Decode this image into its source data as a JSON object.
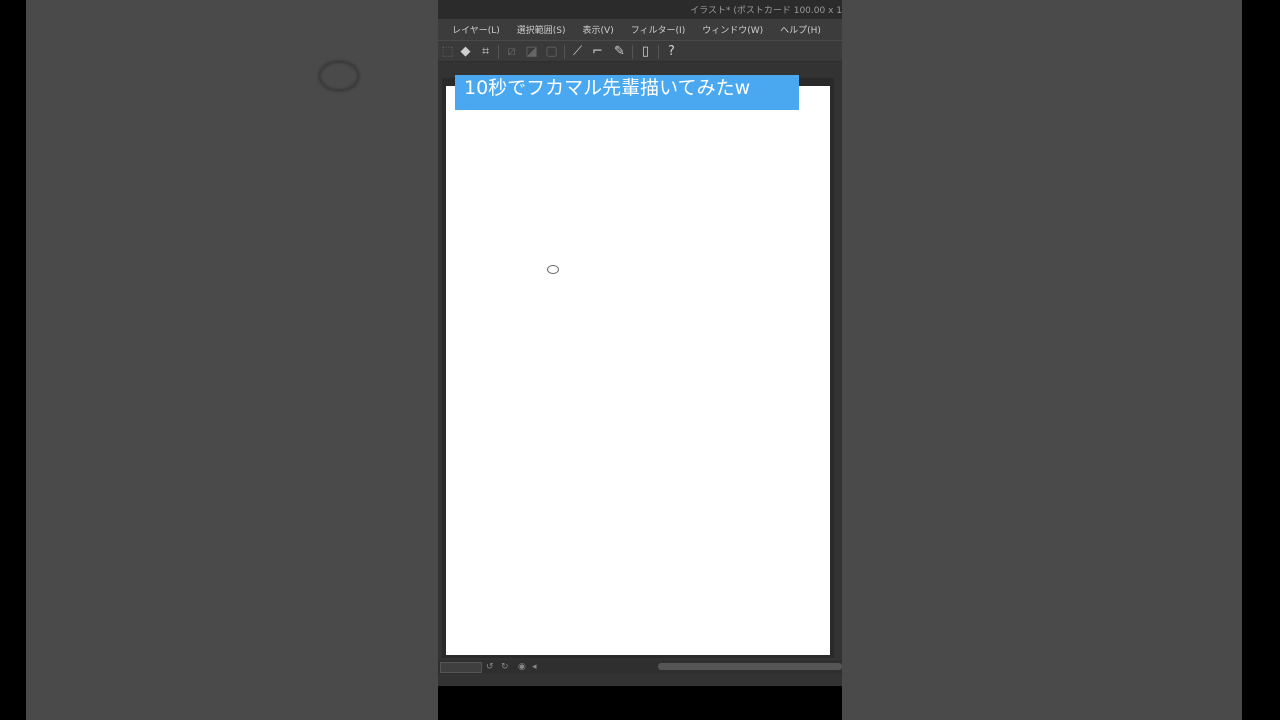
{
  "window": {
    "title": "イラスト* (ポストカード 100.00 x 1"
  },
  "menu": {
    "items": [
      {
        "label": "レイヤー(L)"
      },
      {
        "label": "選択範囲(S)"
      },
      {
        "label": "表示(V)"
      },
      {
        "label": "フィルター(I)"
      },
      {
        "label": "ウィンドウ(W)"
      },
      {
        "label": "ヘルプ(H)"
      }
    ]
  },
  "toolbar": {
    "icons": [
      "select-icon",
      "fill-icon",
      "crop-icon",
      "transform-icon",
      "mask-icon",
      "layer-icon",
      "pen-icon",
      "brush-icon",
      "pencil-icon",
      "device-icon",
      "help-icon"
    ]
  },
  "overlay": {
    "caption": "10秒でフカマル先輩描いてみたw",
    "caption_color": "#4aa8f0"
  }
}
